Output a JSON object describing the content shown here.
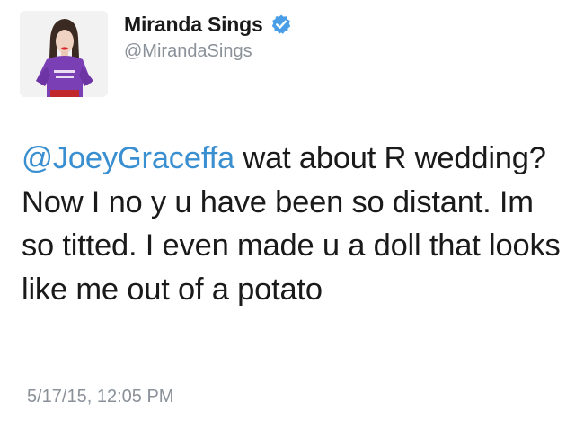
{
  "user": {
    "display_name": "Miranda Sings",
    "handle": "@MirandaSings",
    "verified": true,
    "avatar_icon": "profile-photo"
  },
  "tweet": {
    "mention": "@JoeyGraceffa",
    "text": " wat about R wedding? Now I no y u have been so distant. Im so titted. I even made u a doll that looks like me out of a potato",
    "timestamp": "5/17/15, 12:05 PM"
  },
  "colors": {
    "mention": "#3a8fd0",
    "verified_badge": "#4a9ee8",
    "secondary_text": "#8a9199"
  }
}
